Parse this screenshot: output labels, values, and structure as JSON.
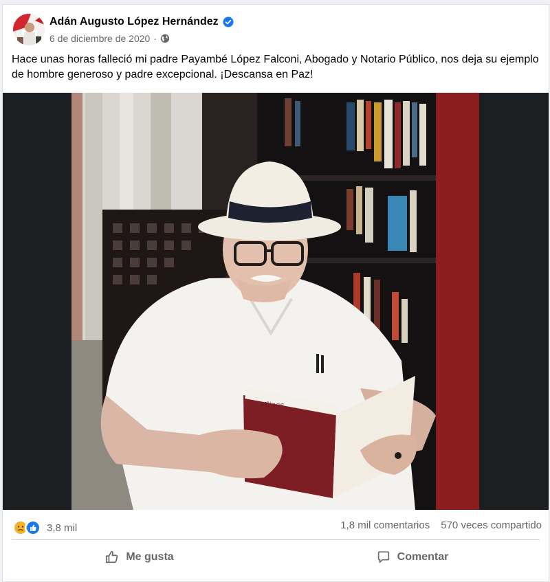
{
  "post": {
    "author": "Adán Augusto López Hernández",
    "date": "6 de diciembre de 2020",
    "separator": "·",
    "text": "Hace unas horas falleció mi padre Payambé López Falconi, Abogado y Notario Público, nos deja su ejemplo de hombre generoso y padre excepcional. ¡Descansa en Paz!",
    "book_title": "Ulises"
  },
  "stats": {
    "reactions": "3,8 mil",
    "comments": "1,8 mil comentarios",
    "shares": "570 veces compartido"
  },
  "actions": {
    "like": "Me gusta",
    "comment": "Comentar"
  },
  "icons": {
    "verified": "verified-badge-icon",
    "audience": "globe-icon",
    "reaction_1": "sad-reaction-icon",
    "reaction_2": "like-reaction-icon",
    "like": "thumbs-up-icon",
    "comment": "speech-bubble-icon"
  },
  "colors": {
    "verified": "#1877f2",
    "like_reaction": "#1877f2",
    "sad_reaction": "#f7b125",
    "secondary_text": "#65676b"
  }
}
